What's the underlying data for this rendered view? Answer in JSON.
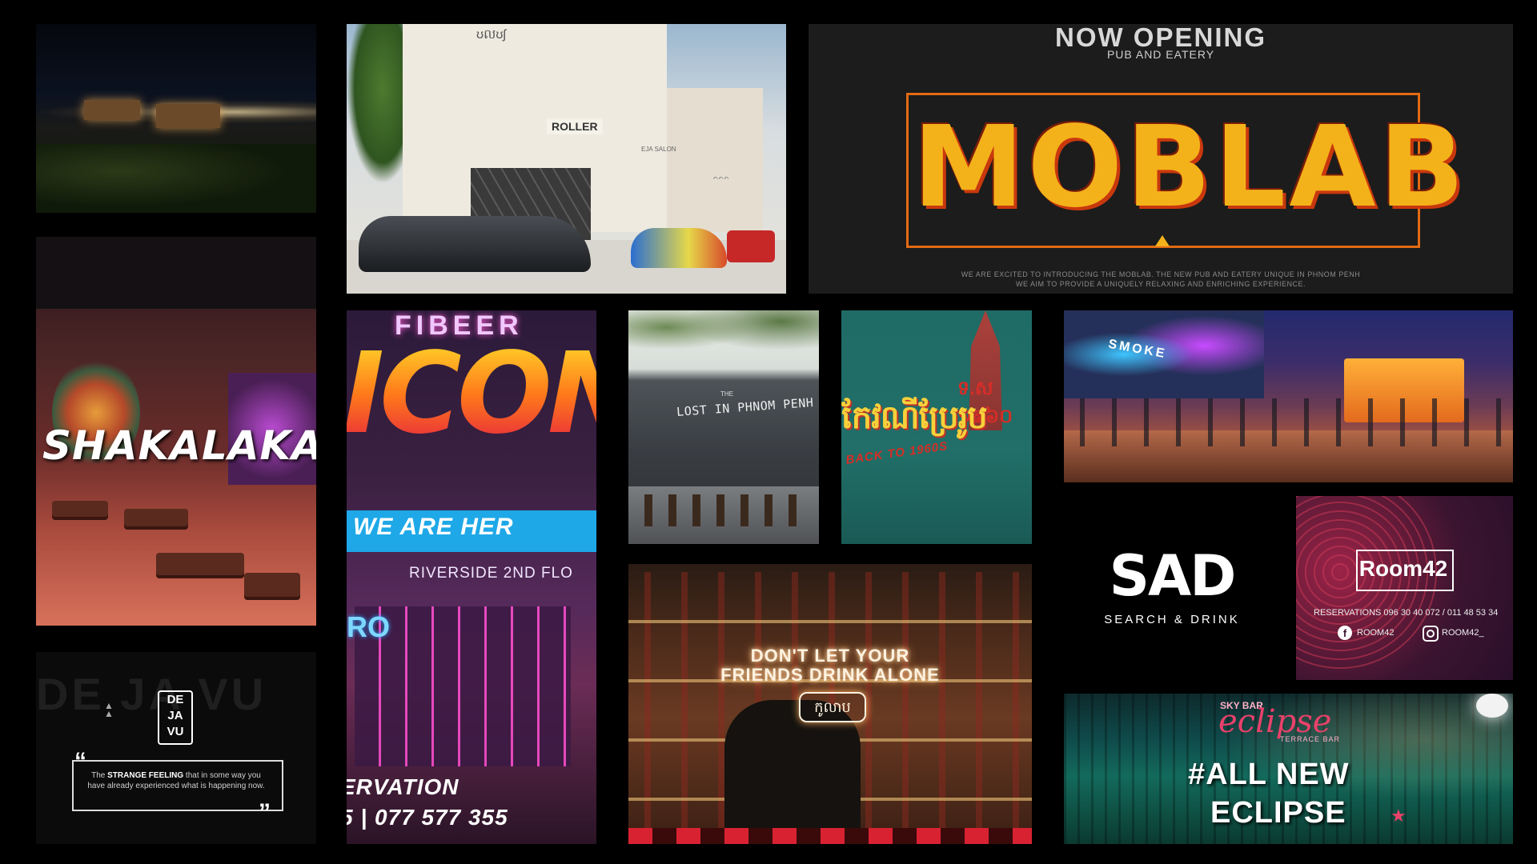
{
  "villa": {
    "roof_sign": "ʊលʊʃ",
    "sign": "ROLLER",
    "salon": "EJA SALON",
    "small": "ᨈᨈᨈ"
  },
  "moblab": {
    "now_opening": "NOW OPENING",
    "pub": "PUB AND EATERY",
    "logo": "MOBLAB",
    "desc1": "WE ARE EXCITED TO INTRODUCING THE MOBLAB. THE NEW PUB AND EATERY UNIQUE IN PHNOM PENH",
    "desc2": "WE AIM TO PROVIDE A UNIQUELY RELAXING AND ENRICHING EXPERIENCE."
  },
  "shakalaka": {
    "title": "SHAKALAKA"
  },
  "dejavu": {
    "logo_l1": "DE",
    "logo_l2": "JA",
    "logo_l3": "VU",
    "big": "DE JA VU",
    "quote_pre": "The ",
    "quote_bold": "STRANGE FEELING",
    "quote_post": " that in some way you have already experienced what is happening now."
  },
  "neon": {
    "top": "FIBEER",
    "logo": "ICON",
    "banner": "WE ARE HER",
    "location": "RIVERSIDE 2ND FLO",
    "ro": "RO",
    "reservation": "ERVATION",
    "phone": "5 | 077 577 355"
  },
  "lost": {
    "the": "THE",
    "name": "LOST IN PHNOM PENH"
  },
  "khmer": {
    "date": "ទ.ស ១៩៦០",
    "title": "កែវណីប្រែរូប",
    "back": "BACK TO 1960S"
  },
  "smoke": {
    "label": "SMOKE"
  },
  "sad": {
    "logo": "SAD",
    "subtitle": "SEARCH & DRINK"
  },
  "room42": {
    "logo": "Room42",
    "reservations": "RESERVATIONS   096 30 40 072  /  011 48 53 34",
    "facebook": "ROOM42",
    "instagram": "ROOM42_"
  },
  "eclipse": {
    "skybar": "SKY BAR",
    "logo": "eclipse",
    "terrace": "TERRACE BAR",
    "line1": "#ALL NEW",
    "line2": "ECLIPSE"
  },
  "bar": {
    "neon1": "DON'T LET YOUR",
    "neon2": "FRIENDS DRINK ALONE",
    "khmer": "កូលាប"
  }
}
